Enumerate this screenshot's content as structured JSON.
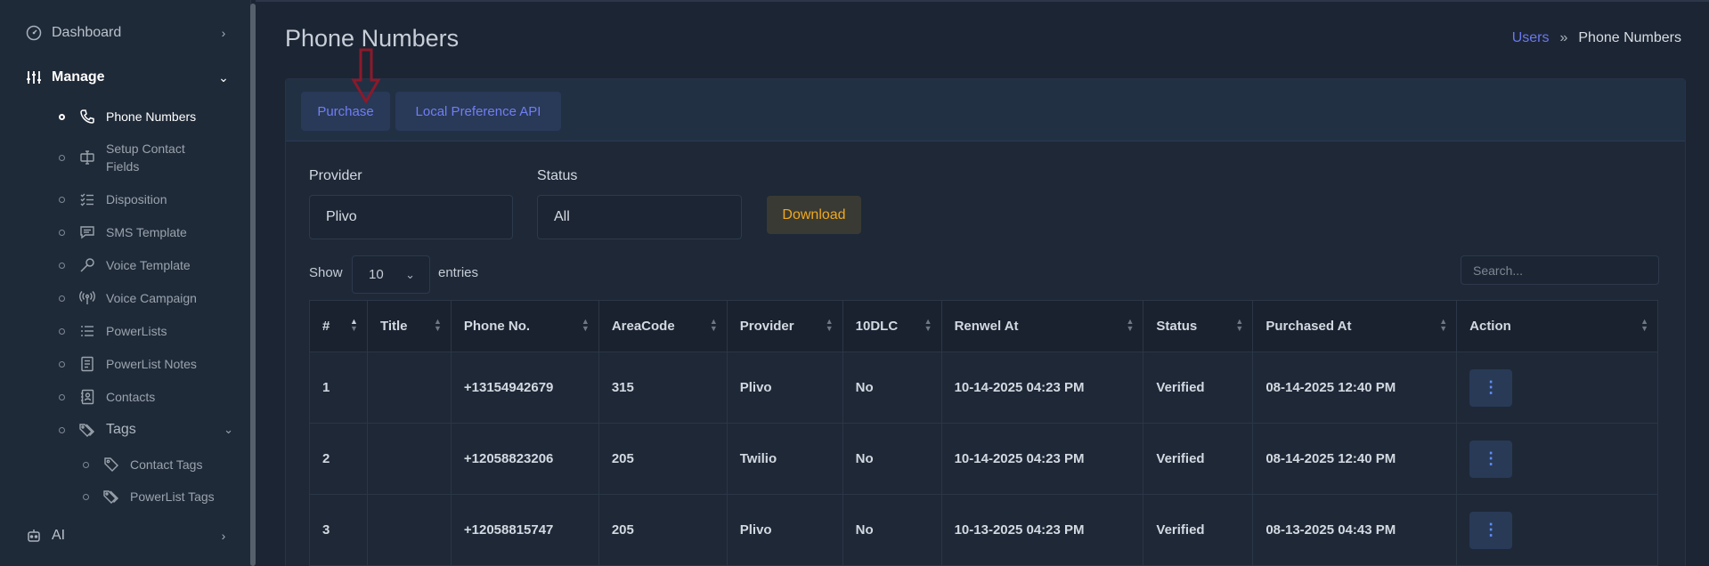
{
  "sidebar": {
    "dashboard": "Dashboard",
    "manage": "Manage",
    "items": [
      {
        "label": "Phone Numbers",
        "icon": "phone-icon"
      },
      {
        "label": "Setup Contact Fields",
        "icon": "form-field-icon"
      },
      {
        "label": "Disposition",
        "icon": "checklist-icon"
      },
      {
        "label": "SMS Template",
        "icon": "message-icon"
      },
      {
        "label": "Voice Template",
        "icon": "microphone-icon"
      },
      {
        "label": "Voice Campaign",
        "icon": "broadcast-icon"
      },
      {
        "label": "PowerLists",
        "icon": "list-icon"
      },
      {
        "label": "PowerList Notes",
        "icon": "notes-icon"
      },
      {
        "label": "Contacts",
        "icon": "contacts-icon"
      }
    ],
    "tags": "Tags",
    "tag_items": [
      {
        "label": "Contact Tags",
        "icon": "tag-icon"
      },
      {
        "label": "PowerList Tags",
        "icon": "tags-icon"
      }
    ],
    "ai": "AI"
  },
  "page_title": "Phone Numbers",
  "breadcrumb": {
    "parent": "Users",
    "separator": "»",
    "current": "Phone Numbers"
  },
  "tabs": {
    "purchase": "Purchase",
    "local_pref": "Local Preference API"
  },
  "filters": {
    "provider_label": "Provider",
    "provider_value": "Plivo",
    "status_label": "Status",
    "status_value": "All",
    "download": "Download"
  },
  "table_controls": {
    "show": "Show",
    "page_length": "10",
    "entries": "entries",
    "search_placeholder": "Search..."
  },
  "table": {
    "headers": [
      "#",
      "Title",
      "Phone No.",
      "AreaCode",
      "Provider",
      "10DLC",
      "Renwel At",
      "Status",
      "Purchased At",
      "Action"
    ],
    "rows": [
      {
        "num": "1",
        "title": "",
        "phone": "+13154942679",
        "area": "315",
        "provider": "Plivo",
        "dlc": "No",
        "renew": "10-14-2025 04:23 PM",
        "status": "Verified",
        "purchased": "08-14-2025 12:40 PM"
      },
      {
        "num": "2",
        "title": "",
        "phone": "+12058823206",
        "area": "205",
        "provider": "Twilio",
        "dlc": "No",
        "renew": "10-14-2025 04:23 PM",
        "status": "Verified",
        "purchased": "08-14-2025 12:40 PM"
      },
      {
        "num": "3",
        "title": "",
        "phone": "+12058815747",
        "area": "205",
        "provider": "Plivo",
        "dlc": "No",
        "renew": "10-13-2025 04:23 PM",
        "status": "Verified",
        "purchased": "08-13-2025 04:43 PM"
      }
    ],
    "action_glyph": "⋮"
  },
  "colors": {
    "accent": "#6978f0",
    "download": "#f0a91c",
    "arrow": "#8b1a2b"
  }
}
